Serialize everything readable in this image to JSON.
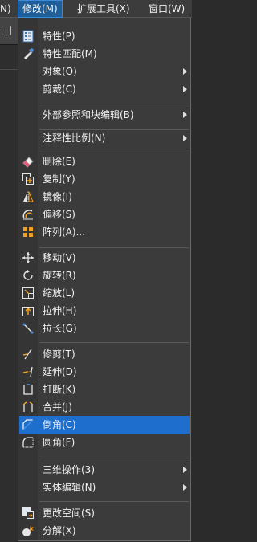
{
  "menubar": {
    "items": [
      {
        "label": "N)"
      },
      {
        "label": "修改(M)"
      },
      {
        "label": "扩展工具(X)"
      },
      {
        "label": "窗口(W)"
      }
    ]
  },
  "menu": {
    "items": [
      {
        "label": "特性(P)",
        "icon": "properties-icon"
      },
      {
        "label": "特性匹配(M)",
        "icon": "match-properties-icon"
      },
      {
        "label": "对象(O)",
        "submenu": true
      },
      {
        "label": "剪裁(C)",
        "submenu": true
      },
      {
        "label": "外部参照和块编辑(B)",
        "submenu": true
      },
      {
        "label": "注释性比例(N)",
        "submenu": true
      },
      {
        "label": "删除(E)",
        "icon": "erase-icon"
      },
      {
        "label": "复制(Y)",
        "icon": "copy-icon"
      },
      {
        "label": "镜像(I)",
        "icon": "mirror-icon"
      },
      {
        "label": "偏移(S)",
        "icon": "offset-icon"
      },
      {
        "label": "阵列(A)...",
        "icon": "array-icon"
      },
      {
        "label": "移动(V)",
        "icon": "move-icon"
      },
      {
        "label": "旋转(R)",
        "icon": "rotate-icon"
      },
      {
        "label": "缩放(L)",
        "icon": "scale-icon"
      },
      {
        "label": "拉伸(H)",
        "icon": "stretch-icon"
      },
      {
        "label": "拉长(G)",
        "icon": "lengthen-icon"
      },
      {
        "label": "修剪(T)",
        "icon": "trim-icon"
      },
      {
        "label": "延伸(D)",
        "icon": "extend-icon"
      },
      {
        "label": "打断(K)",
        "icon": "break-icon"
      },
      {
        "label": "合并(J)",
        "icon": "join-icon"
      },
      {
        "label": "倒角(C)",
        "icon": "chamfer-icon",
        "highlighted": true
      },
      {
        "label": "圆角(F)",
        "icon": "fillet-icon"
      },
      {
        "label": "三维操作(3)",
        "submenu": true
      },
      {
        "label": "实体编辑(N)",
        "submenu": true
      },
      {
        "label": "更改空间(S)",
        "icon": "change-space-icon"
      },
      {
        "label": "分解(X)",
        "icon": "explode-icon"
      }
    ]
  },
  "colors": {
    "menu_bg": "#3b3b3b",
    "highlight": "#1e6fcd",
    "text": "#f2f2f2",
    "accent_orange": "#f0a020"
  }
}
